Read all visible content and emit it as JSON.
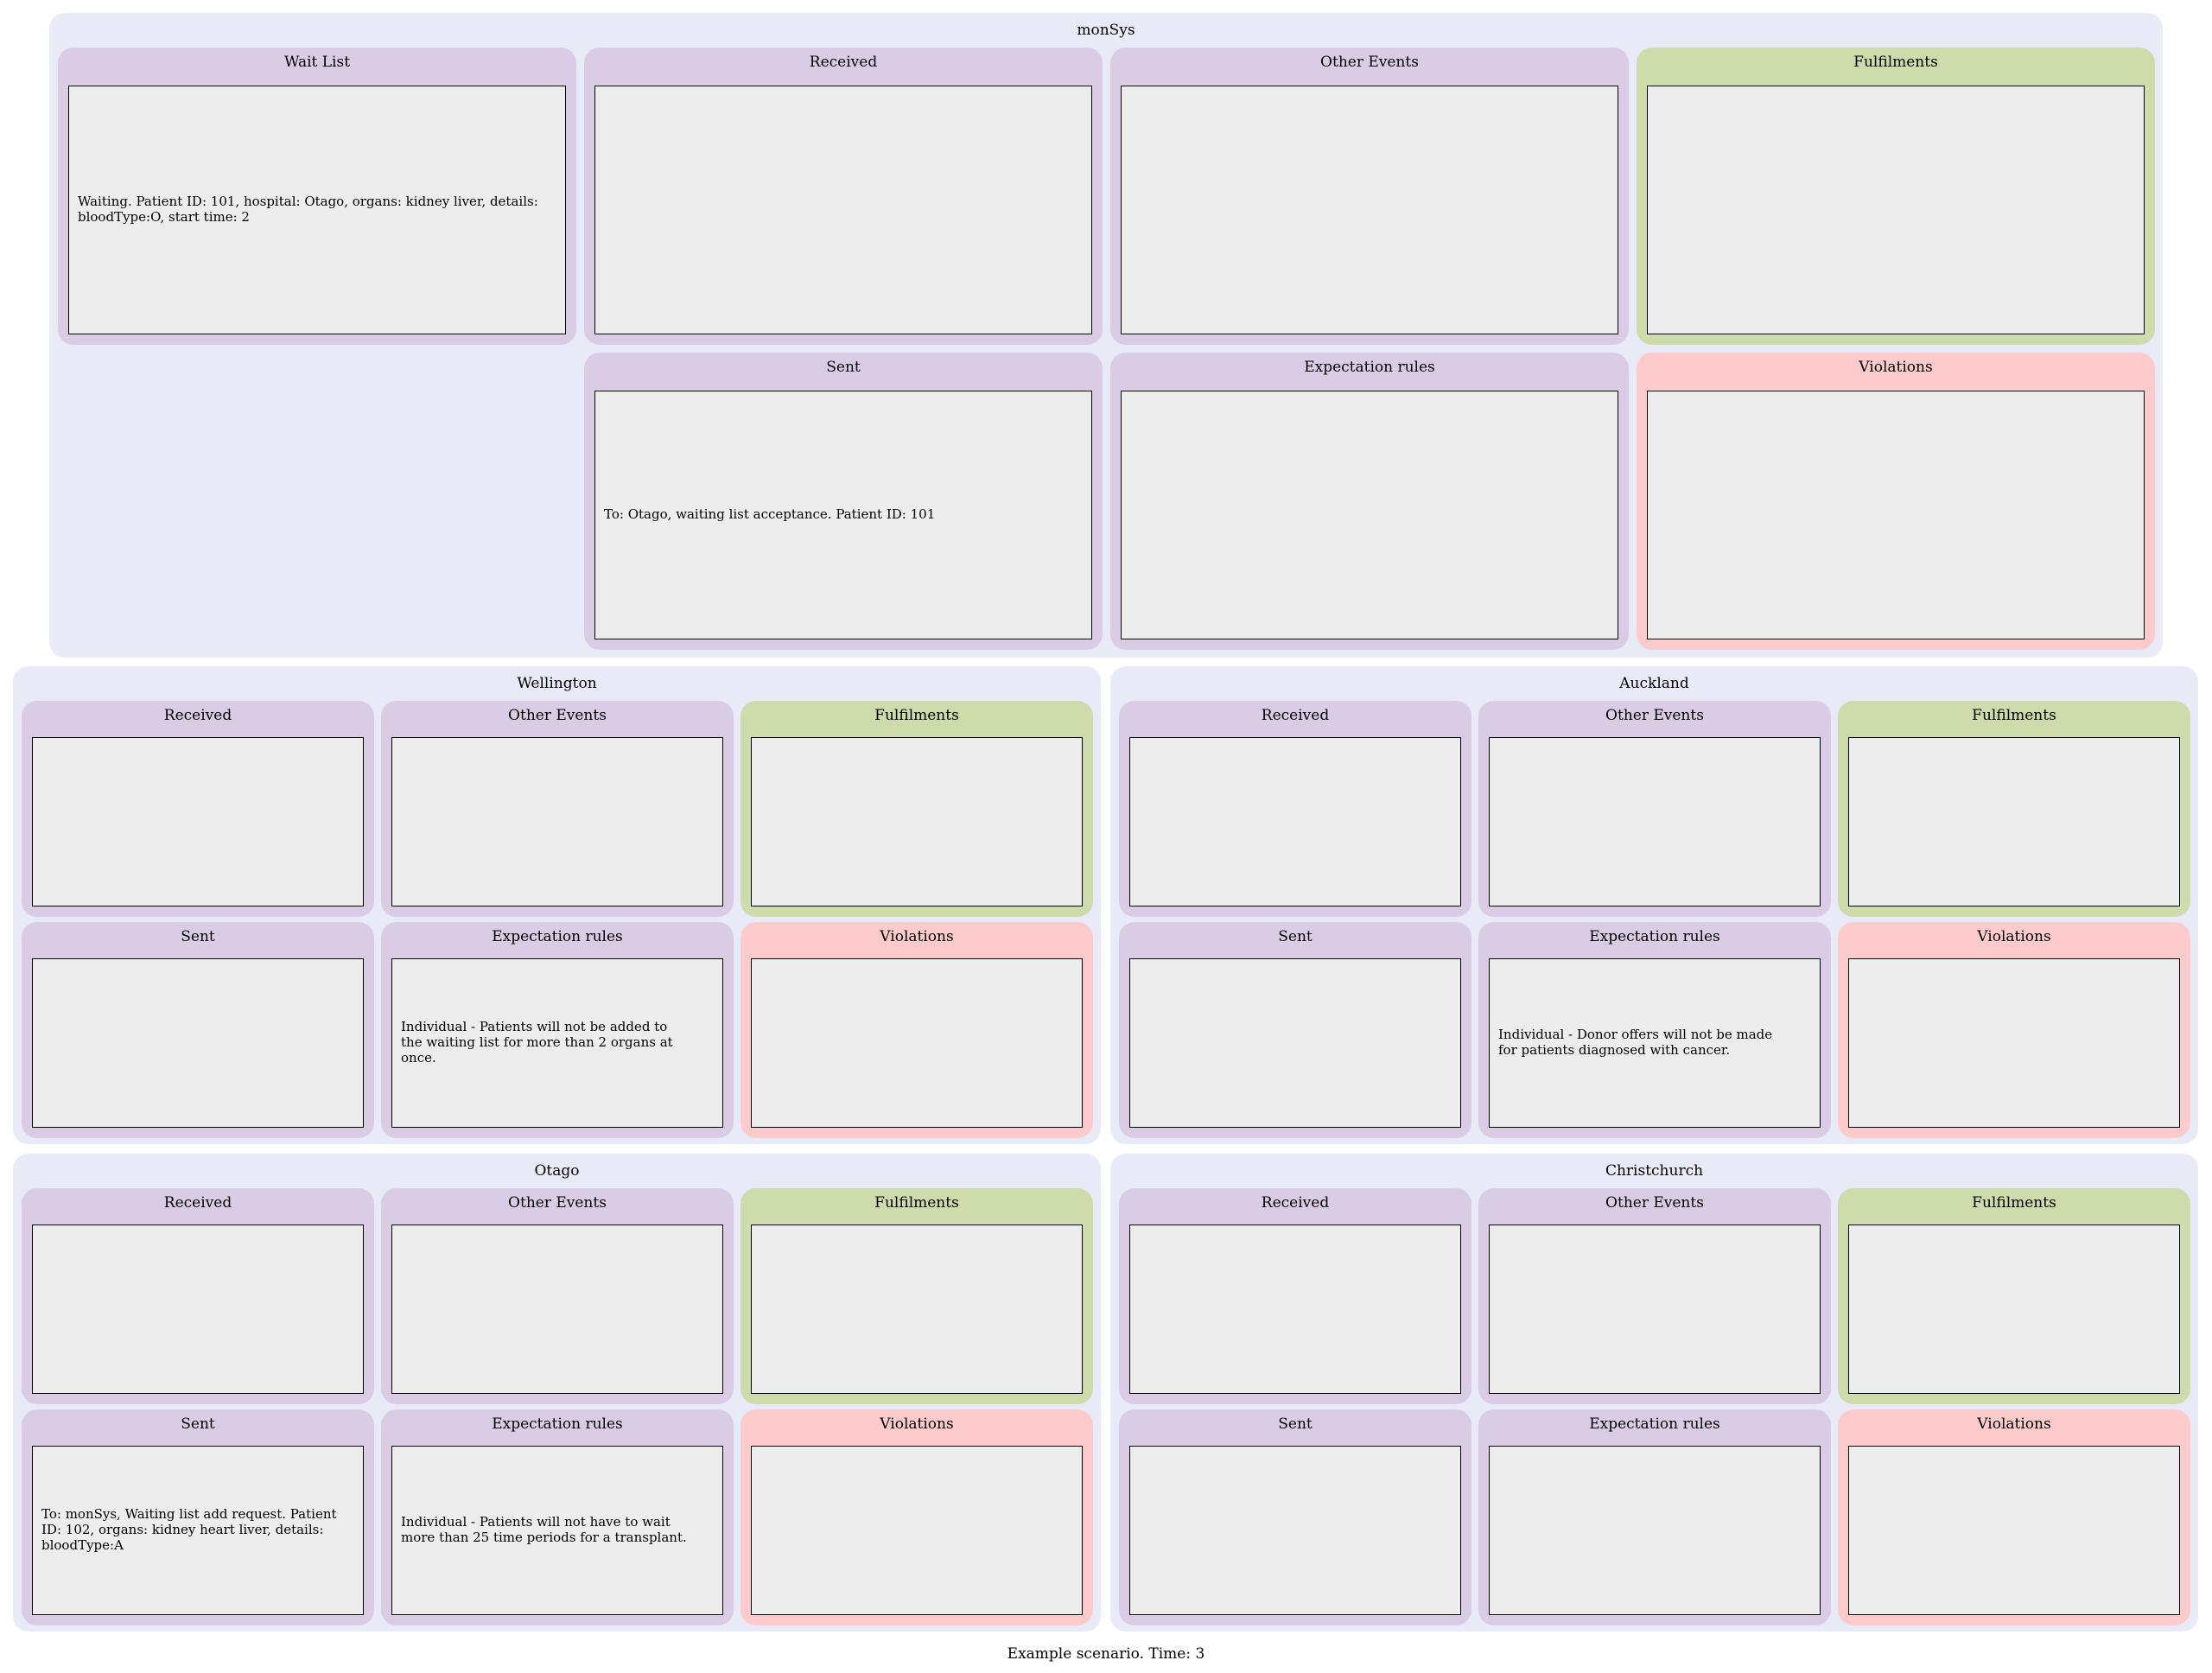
{
  "caption": "Example scenario. Time: 3",
  "labels": {
    "wait_list": "Wait List",
    "received": "Received",
    "other_events": "Other Events",
    "fulfilments": "Fulfilments",
    "sent": "Sent",
    "expectation_rules": "Expectation rules",
    "violations": "Violations"
  },
  "clusters": {
    "monsys": {
      "name": "monSys",
      "wait_list": "Waiting. Patient ID: 101, hospital: Otago, organs: kidney liver, details:\nbloodType:O, start time: 2",
      "received": "",
      "other_events": "",
      "fulfilments": "",
      "sent": "To: Otago, waiting list acceptance. Patient ID: 101",
      "expectation_rules": "",
      "violations": ""
    },
    "wellington": {
      "name": "Wellington",
      "received": "",
      "other_events": "",
      "fulfilments": "",
      "sent": "",
      "expectation_rules": "Individual - Patients will not be added to\nthe waiting list for more than 2 organs at\nonce.",
      "violations": ""
    },
    "auckland": {
      "name": "Auckland",
      "received": "",
      "other_events": "",
      "fulfilments": "",
      "sent": "",
      "expectation_rules": "Individual - Donor offers will not be made\nfor patients diagnosed with cancer.",
      "violations": ""
    },
    "otago": {
      "name": "Otago",
      "received": "",
      "other_events": "",
      "fulfilments": "",
      "sent": "To: monSys, Waiting list add request. Patient\nID: 102, organs: kidney heart liver, details:\nbloodType:A",
      "expectation_rules": "Individual - Patients will not have to wait\nmore than 25 time periods for a transplant.",
      "violations": ""
    },
    "christchurch": {
      "name": "Christchurch",
      "received": "",
      "other_events": "",
      "fulfilments": "",
      "sent": "",
      "expectation_rules": "",
      "violations": ""
    }
  },
  "colors": {
    "cluster_bg": "#e8eaf8",
    "panel_purple": "#d9cce4",
    "panel_green": "#cddcaa",
    "panel_pink": "#fdcbcb",
    "box_bg": "#ededed"
  }
}
